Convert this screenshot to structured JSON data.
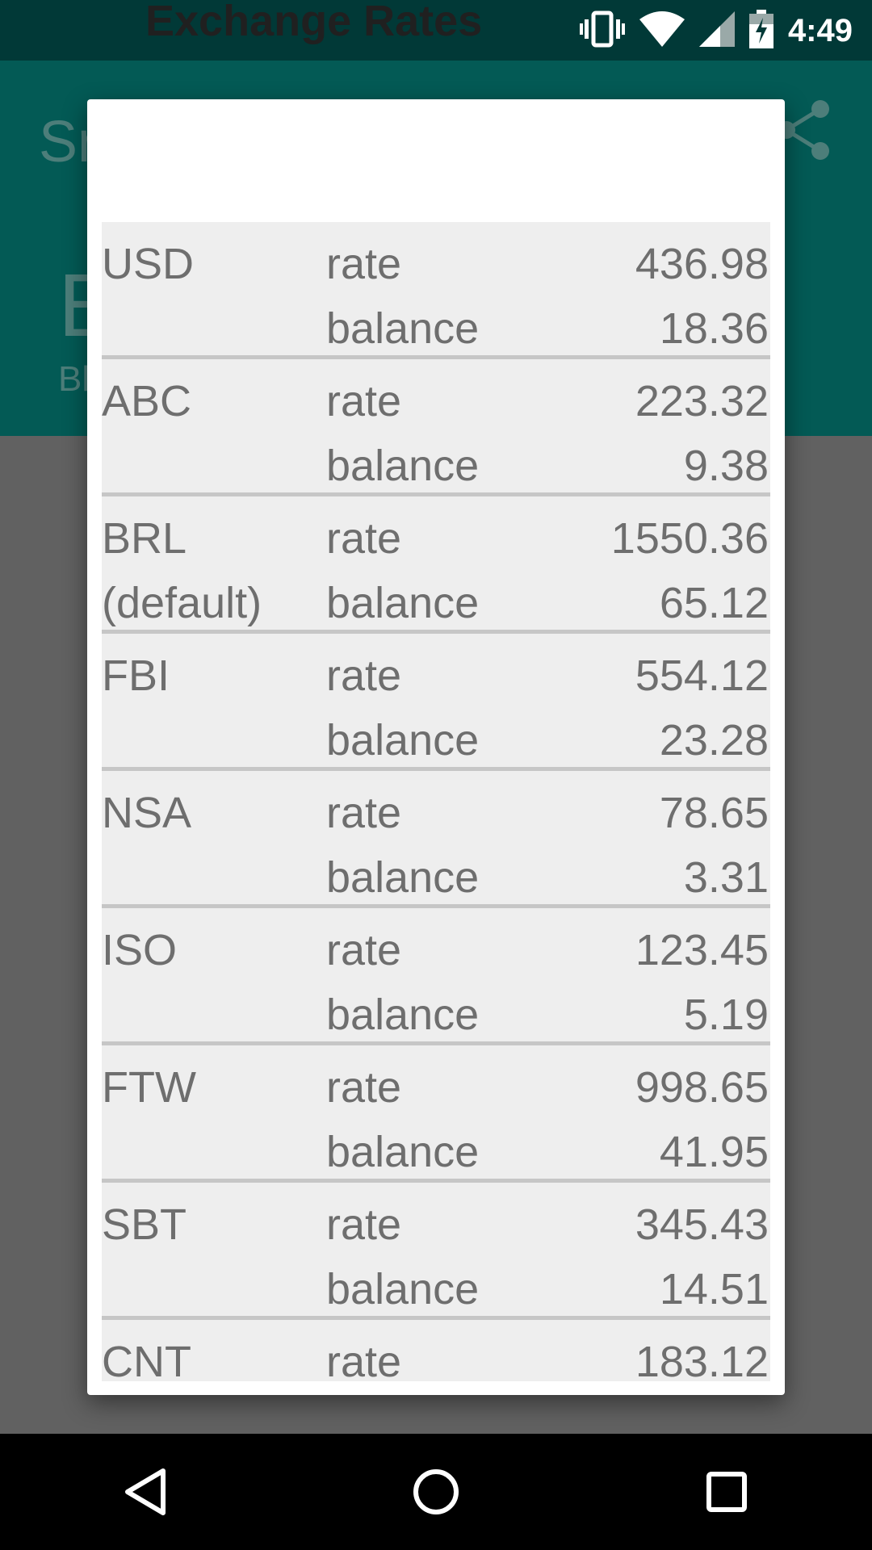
{
  "status_bar": {
    "time": "4:49"
  },
  "app_bar": {
    "title_partial": "Sr",
    "big_partial": "E",
    "small_partial": "Bl"
  },
  "dialog": {
    "title": "Exchange Rates",
    "rows": [
      {
        "code": "USD",
        "code2": "",
        "rate_label": "rate",
        "rate": "436.98",
        "balance_label": "balance",
        "balance": "18.36"
      },
      {
        "code": "ABC",
        "code2": "",
        "rate_label": "rate",
        "rate": "223.32",
        "balance_label": "balance",
        "balance": "9.38"
      },
      {
        "code": "BRL",
        "code2": "(default)",
        "rate_label": "rate",
        "rate": "1550.36",
        "balance_label": "balance",
        "balance": "65.12"
      },
      {
        "code": "FBI",
        "code2": "",
        "rate_label": "rate",
        "rate": "554.12",
        "balance_label": "balance",
        "balance": "23.28"
      },
      {
        "code": "NSA",
        "code2": "",
        "rate_label": "rate",
        "rate": "78.65",
        "balance_label": "balance",
        "balance": "3.31"
      },
      {
        "code": "ISO",
        "code2": "",
        "rate_label": "rate",
        "rate": "123.45",
        "balance_label": "balance",
        "balance": "5.19"
      },
      {
        "code": "FTW",
        "code2": "",
        "rate_label": "rate",
        "rate": "998.65",
        "balance_label": "balance",
        "balance": "41.95"
      },
      {
        "code": "SBT",
        "code2": "",
        "rate_label": "rate",
        "rate": "345.43",
        "balance_label": "balance",
        "balance": "14.51"
      },
      {
        "code": "CNT",
        "code2": "",
        "rate_label": "rate",
        "rate": "183.12",
        "balance_label": "",
        "balance": ""
      }
    ]
  },
  "icons": {
    "vibrate": "vibrate-icon",
    "wifi": "wifi-icon",
    "signal": "signal-icon",
    "battery": "battery-charging-icon",
    "share": "share-icon",
    "back": "back-icon",
    "home": "home-icon",
    "recents": "recents-icon"
  },
  "colors": {
    "status_bar": "#013937",
    "app_bar": "#035a55",
    "dialog_bg": "#ffffff",
    "table_bg": "#eeeeee",
    "text": "#6e6e6e"
  }
}
